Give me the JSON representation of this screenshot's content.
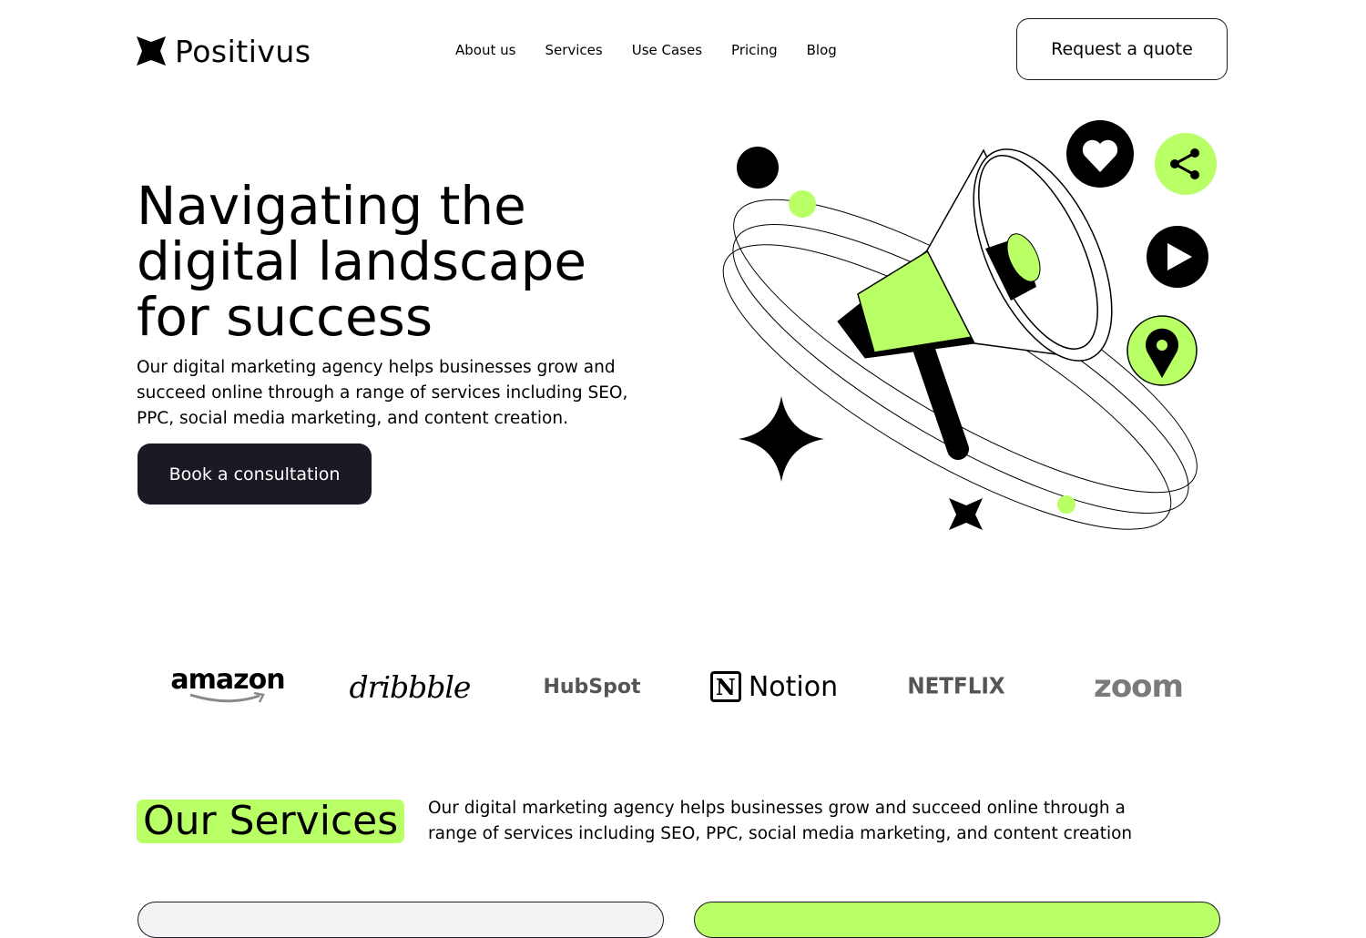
{
  "header": {
    "brand": "Positivus",
    "nav": [
      "About us",
      "Services",
      "Use Cases",
      "Pricing",
      "Blog"
    ],
    "cta_label": "Request a quote"
  },
  "hero": {
    "title_lines": [
      "Navigating the",
      "digital landscape",
      "for success"
    ],
    "text": "Our digital marketing agency helps businesses grow and succeed online through a range of services including SEO, PPC, social media marketing, and content creation.",
    "button_label": "Book a consultation"
  },
  "logos": {
    "amazon": "amazon",
    "dribbble": "dribbble",
    "hubspot": "HubSpot",
    "notion_mark": "N",
    "notion": "Notion",
    "netflix": "NETFLIX",
    "zoom": "zoom"
  },
  "services": {
    "title": "Our Services",
    "text": "Our digital marketing agency helps businesses grow and succeed online through a range of services including SEO, PPC, social media marketing, and content creation"
  },
  "colors": {
    "accent": "#b9ff66",
    "dark": "#191a23",
    "light": "#f3f3f3"
  },
  "icons": [
    "logo-star-icon",
    "heart-icon",
    "share-icon",
    "play-icon",
    "location-pin-icon",
    "megaphone-illustration",
    "sparkle-icon"
  ]
}
